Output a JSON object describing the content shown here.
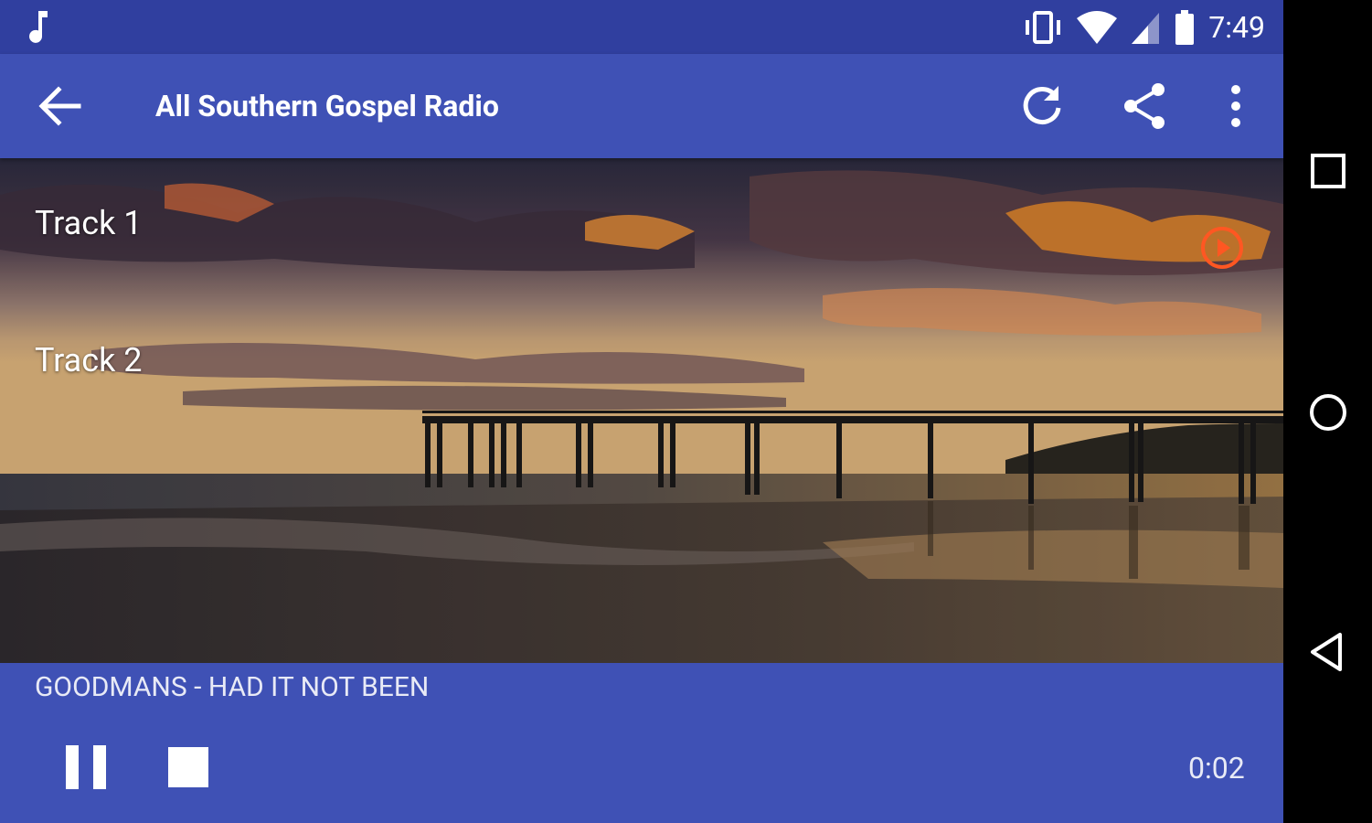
{
  "status_bar": {
    "time": "7:49",
    "icons": [
      "music-note-icon",
      "vibrate-icon",
      "wifi-icon",
      "cell-signal-icon",
      "battery-icon"
    ]
  },
  "app_bar": {
    "title": "All Southern Gospel Radio",
    "actions": [
      "back-arrow-icon",
      "refresh-icon",
      "share-icon",
      "more-vert-icon"
    ]
  },
  "tracks": [
    {
      "label": "Track 1"
    },
    {
      "label": "Track 2"
    }
  ],
  "player": {
    "now_playing": "GOODMANS - HAD IT NOT BEEN",
    "elapsed": "0:02",
    "controls": [
      "pause-icon",
      "stop-icon"
    ]
  },
  "colors": {
    "status_bar": "#303f9f",
    "primary": "#3f51b5",
    "accent": "#ff5722",
    "nav_bar": "#000000"
  },
  "nav_bar": {
    "buttons": [
      "recents-square-icon",
      "home-circle-icon",
      "back-triangle-icon"
    ]
  }
}
